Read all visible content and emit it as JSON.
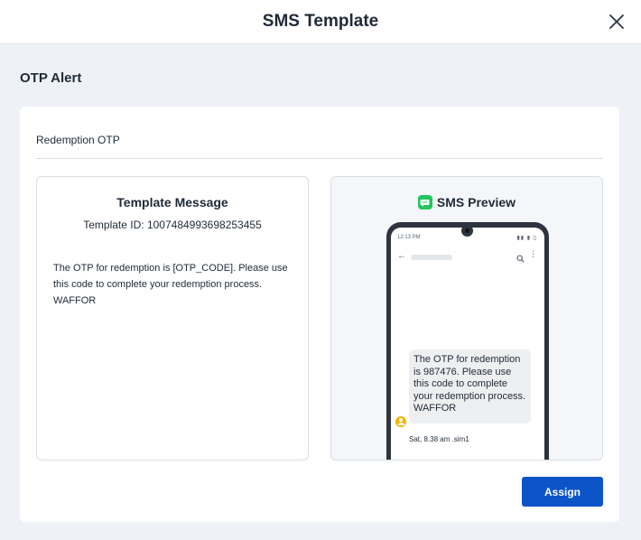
{
  "modal": {
    "title": "SMS Template",
    "close_icon": "close-icon"
  },
  "section": {
    "title": "OTP Alert"
  },
  "card": {
    "heading": "Redemption OTP",
    "template": {
      "title": "Template Message",
      "id_text": "Template ID: 1007484993698253455",
      "body": "The OTP for redemption is [OTP_CODE]. Please use this code to complete your redemption process. WAFFOR"
    },
    "preview": {
      "title": "SMS Preview",
      "icon": "message-icon",
      "phone": {
        "status_time": "12:13 PM",
        "status_icons": "▮▮ ▮ ▯",
        "message": "The OTP for redemption is 987476. Please use this code to complete your redemption process. WAFFOR",
        "meta": "Sat, 8.38 am .sim1"
      }
    },
    "assign_label": "Assign"
  },
  "colors": {
    "primary": "#0b55c8",
    "background": "#eef2f7",
    "sms_icon": "#22c55e",
    "avatar": "#f4b400"
  }
}
